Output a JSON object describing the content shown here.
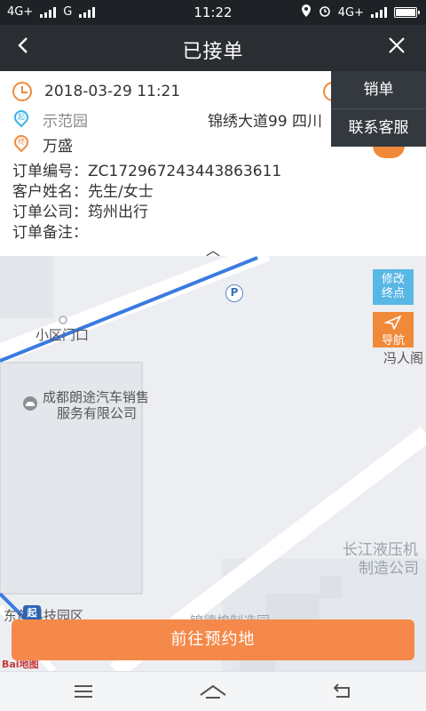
{
  "status_bar": {
    "network_left_1": "4G+",
    "network_left_2": "G",
    "time": "11:22",
    "network_right": "4G+"
  },
  "header": {
    "title": "已接单",
    "back_glyph": "‹",
    "close_glyph": "✕"
  },
  "order": {
    "datetime": "2018-03-29 11:21",
    "start_badge": "起",
    "start_place": "示范园",
    "start_address": "锦绣大道99 四川",
    "end_badge": "终",
    "end_place": "万盛",
    "number_label": "订单编号：",
    "number_value": "ZC172967243443863611",
    "customer_label": "客户姓名：",
    "customer_value": "先生/女士",
    "company_label": "订单公司：",
    "company_value": "筠州出行",
    "note_label": "订单备注：",
    "note_value": ""
  },
  "menu": {
    "items": [
      {
        "label": "销单"
      },
      {
        "label": "联系客服"
      }
    ]
  },
  "map": {
    "collapse_glyph": "︿",
    "labels": {
      "gate": "小区门口",
      "dealer_line1": "成都朗途汽车销售",
      "dealer_line2": "服务有限公司",
      "feng": "冯人阁",
      "hydraulic_line1": "长江液压机",
      "hydraulic_line2": "制造公司",
      "tech_park": "东创科技园区",
      "bottom_road": "锦德棉制造园"
    },
    "parking_glyph": "P",
    "start_badge": "起",
    "logo": "Bai地图",
    "buttons": {
      "modify_end_line1": "修改",
      "modify_end_line2": "终点",
      "navigate": "导航"
    },
    "colors": {
      "route": "#3a7be0",
      "modify_end": "#59b7e6",
      "navigate": "#f08a3a"
    }
  },
  "cta": {
    "label": "前往预约地",
    "color": "#f5894a"
  },
  "navbar": {
    "menu_icon": "≡",
    "home_icon": "⌂",
    "back_icon": "↶"
  }
}
